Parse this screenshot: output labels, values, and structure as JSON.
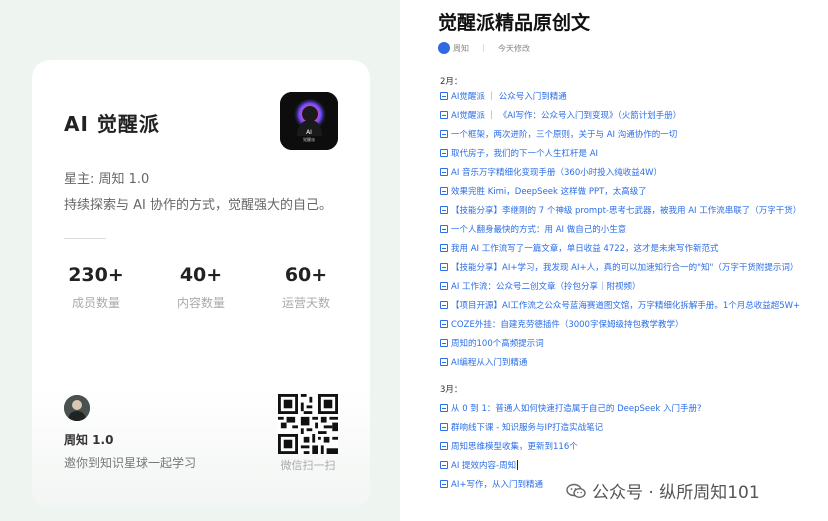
{
  "card": {
    "brand": "AI 觉醒派",
    "icon_text_top": "AI",
    "icon_text_bottom": "觉醒派",
    "owner": "星主: 周知 1.0",
    "tagline": "持续探索与 AI 协作的方式，觉醒强大的自己。",
    "stats": [
      {
        "value": "230+",
        "label": "成员数量"
      },
      {
        "value": "40+",
        "label": "内容数量"
      },
      {
        "value": "60+",
        "label": "运营天数"
      }
    ],
    "author": "周知 1.0",
    "invite": "邀你到知识星球一起学习",
    "qr_label": "微信扫一扫"
  },
  "article": {
    "title": "觉醒派精品原创文",
    "meta_author": "周知",
    "meta_updated": "今天修改",
    "sections": [
      {
        "label": "2月：",
        "items": [
          "AI觉醒派 ｜ 公众号入门到精通",
          "AI觉醒派 ｜ 《AI写作：公众号入门到变现》（火箭计划手册）",
          "一个框架，两次进阶，三个原则，关于与 AI 沟通协作的一切",
          "取代房子，我们的下一个人生杠杆是 AI",
          "AI 音乐万字精细化变现手册（360小时投入纯收益4W）",
          "效果完胜 Kimi，DeepSeek 这样做 PPT，太高级了",
          "【技能分享】李继刚的 7 个神级 prompt-思考七武器，被我用 AI 工作流串联了（万字干货）",
          "一个人翻身最快的方式：用 AI 做自己的小生意",
          "我用 AI 工作流写了一篇文章，单日收益 4722，这才是未来写作新范式",
          "【技能分享】AI+学习，我发现 AI+人，真的可以加速知行合一的\"知\"（万字干货附提示词）",
          "AI 工作流：公众号二创文章（拎包分享｜附视频）",
          "【项目开源】AI工作流之公众号蓝海赛道图文馆，万字精细化拆解手册。1个月总收益超5W+",
          "COZE外挂：自建克劳德插件（3000字保姆级持包教学教学）",
          "周知的100个高频提示词",
          "AI编程从入门到精通"
        ]
      },
      {
        "label": "3月：",
        "items": [
          "从 0 到 1：普通人如何快速打造属于自己的 DeepSeek 入门手册?",
          "群响线下课 - 知识服务与IP打造实战笔记",
          "周知思维模型收集，更新到116个",
          "AI 提效内容-周知",
          "AI+写作，从入门到精通"
        ]
      }
    ]
  },
  "watermark": "公众号 · 纵所周知101",
  "colors": {
    "link": "#2b6ee8",
    "left_background": "#eef5f1",
    "card_background": "#ffffff"
  }
}
